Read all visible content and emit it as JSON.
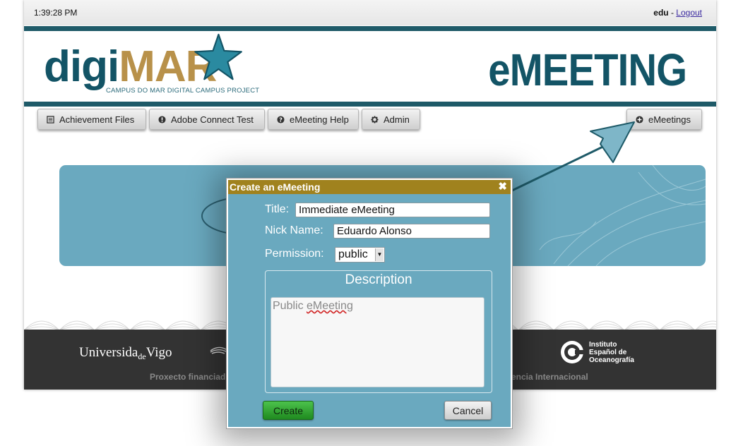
{
  "topbar": {
    "time": "1:39:28 PM",
    "user": "edu",
    "separator": " - ",
    "logout": "Logout"
  },
  "brand": {
    "logo_part1": "digi",
    "logo_part2": "MAR",
    "logo_subtitle": "CAMPUS DO MAR DIGITAL CAMPUS PROJECT",
    "app_title": "eMEETING",
    "colors": {
      "teal": "#135466",
      "gold": "#b8914a",
      "banner": "#6aa9bf"
    }
  },
  "nav": {
    "items": [
      {
        "label": "Achievement Files",
        "icon": "list-icon"
      },
      {
        "label": "Adobe Connect Test",
        "icon": "exclamation-icon"
      },
      {
        "label": "eMeeting Help",
        "icon": "question-icon"
      },
      {
        "label": "Admin",
        "icon": "gear-icon"
      }
    ],
    "right": {
      "label": "eMeetings",
      "icon": "plus-circle-icon"
    }
  },
  "footer": {
    "university": "Universida",
    "university_de": "de",
    "university_vigo": "Vigo",
    "funded_text": "Proxecto financiad",
    "agency_text": "encia Internacional",
    "ieo_line1": "Instituto",
    "ieo_line2": "Español de",
    "ieo_line3": "Oceanografía"
  },
  "dialog": {
    "title": "Create an eMeeting",
    "close_glyph": "✖",
    "title_label": "Title:",
    "title_value": "Immediate eMeeting",
    "nick_label": "Nick Name:",
    "nick_value": "Eduardo Alonso",
    "permission_label": "Permission:",
    "permission_value": "public",
    "description_legend": "Description",
    "description_word1": "Public",
    "description_word2": "eMeeting",
    "create_label": "Create",
    "cancel_label": "Cancel"
  }
}
